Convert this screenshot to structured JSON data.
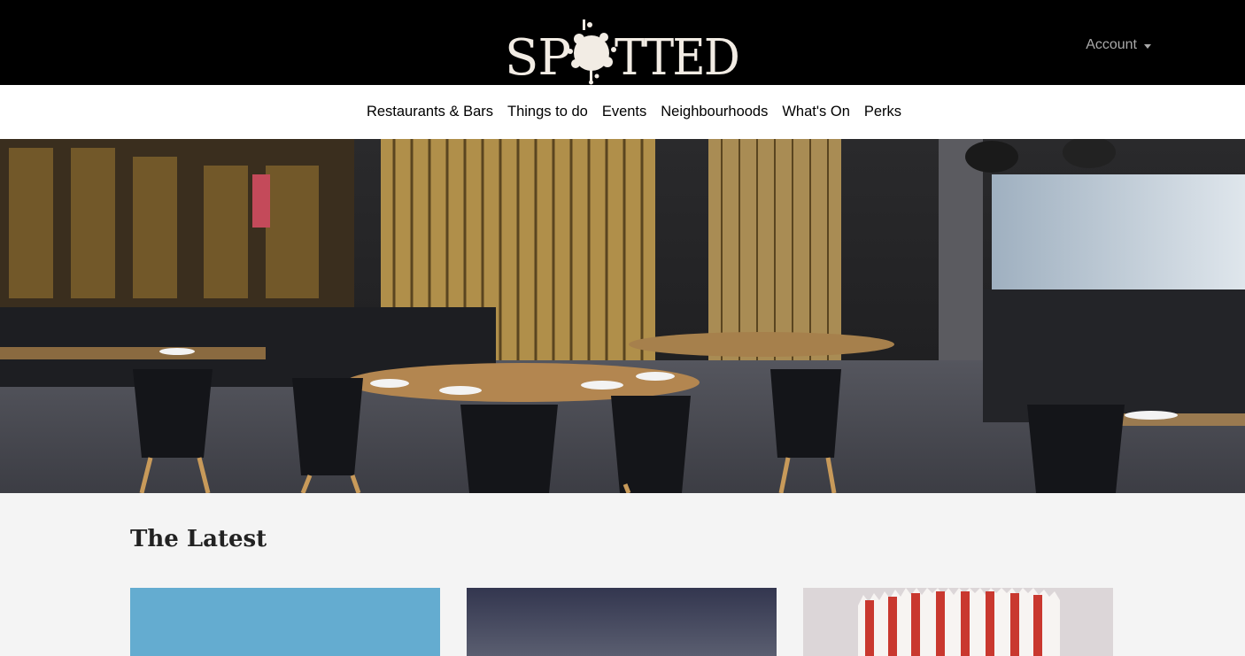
{
  "header": {
    "logo_text": "SPOTTED",
    "account_label": "Account"
  },
  "nav": {
    "items": [
      {
        "label": "Restaurants & Bars"
      },
      {
        "label": "Things to do"
      },
      {
        "label": "Events"
      },
      {
        "label": "Neighbourhoods"
      },
      {
        "label": "What's On"
      },
      {
        "label": "Perks"
      }
    ]
  },
  "latest": {
    "title": "The Latest"
  },
  "colors": {
    "topbar": "#000000",
    "logo": "#f2ece4",
    "account": "#a9a9a9",
    "page_bg": "#f4f4f4"
  },
  "icons": [
    "caret-down-icon"
  ]
}
